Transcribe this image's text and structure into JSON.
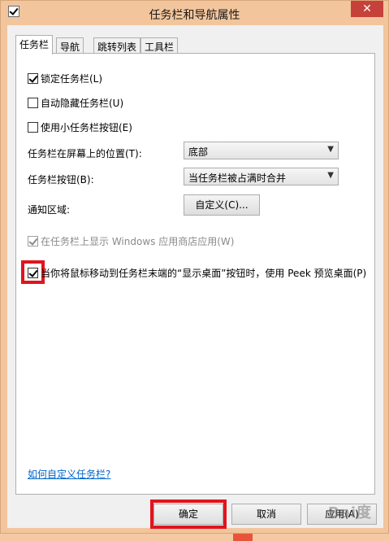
{
  "window": {
    "title": "任务栏和导航属性",
    "close_glyph": "✕"
  },
  "tabs": [
    {
      "label": "任务栏",
      "active": true
    },
    {
      "label": "导航",
      "active": false
    },
    {
      "label": "跳转列表",
      "active": false
    },
    {
      "label": "工具栏",
      "active": false
    }
  ],
  "options": {
    "lock_taskbar": {
      "label": "锁定任务栏(L)",
      "checked": true
    },
    "auto_hide": {
      "label": "自动隐藏任务栏(U)",
      "checked": false
    },
    "small_buttons": {
      "label": "使用小任务栏按钮(E)",
      "checked": false
    },
    "store_apps": {
      "label": "在任务栏上显示 Windows 应用商店应用(W)",
      "checked": true,
      "disabled": true
    },
    "peek": {
      "label": "当你将鼠标移动到任务栏末端的“显示桌面”按钮时，使用 Peek 预览桌面(P)",
      "checked": true
    }
  },
  "position": {
    "label": "任务栏在屏幕上的位置(T):",
    "value": "底部"
  },
  "buttons_combine": {
    "label": "任务栏按钮(B):",
    "value": "当任务栏被占满时合并"
  },
  "notification": {
    "label": "通知区域:",
    "button_label": "自定义(C)..."
  },
  "help_link": "如何自定义任务栏?",
  "footer": {
    "ok_label": "确定",
    "cancel_label": "取消",
    "apply_label": "应用(A)"
  },
  "watermark": "Bai度",
  "colors": {
    "highlight": "#e0141e",
    "link": "#0066cc",
    "close": "#c7413b"
  }
}
